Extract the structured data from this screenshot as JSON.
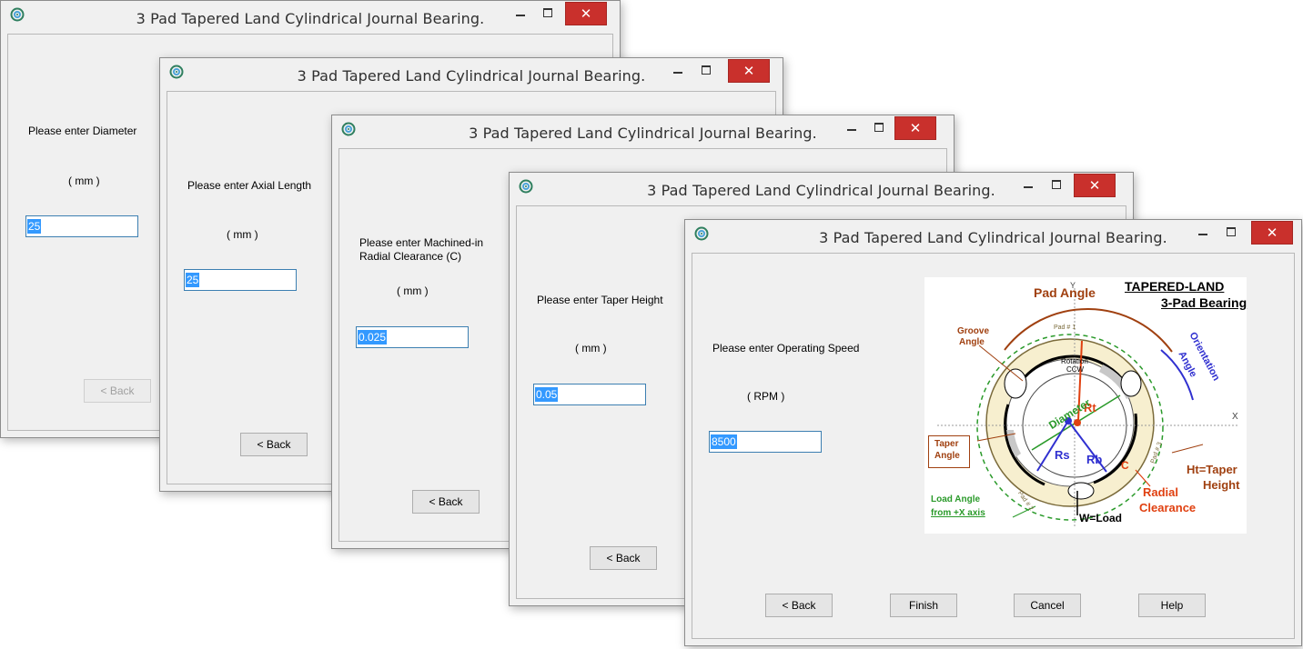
{
  "windows": [
    {
      "title": "3 Pad Tapered Land Cylindrical Journal Bearing.",
      "prompt": "Please enter Diameter",
      "unit": "( mm )",
      "value": "25",
      "back_label": "< Back"
    },
    {
      "title": "3 Pad Tapered Land Cylindrical Journal Bearing.",
      "prompt": "Please enter Axial Length",
      "unit": "( mm )",
      "value": "25",
      "back_label": "< Back"
    },
    {
      "title": "3 Pad Tapered Land Cylindrical Journal Bearing.",
      "prompt_line1": "Please enter Machined-in",
      "prompt_line2": "Radial Clearance (C)",
      "unit": "( mm )",
      "value": "0.025",
      "back_label": "< Back"
    },
    {
      "title": "3 Pad Tapered Land Cylindrical Journal Bearing.",
      "prompt": "Please enter Taper Height",
      "unit": "( mm )",
      "value": "0.05",
      "back_label": "< Back"
    },
    {
      "title": "3 Pad Tapered Land Cylindrical Journal Bearing.",
      "prompt": "Please enter Operating Speed",
      "unit": "( RPM )",
      "value": "8500",
      "back_label": "< Back",
      "finish_label": "Finish",
      "cancel_label": "Cancel",
      "help_label": "Help"
    }
  ],
  "diagram": {
    "title_line1": "TAPERED-LAND",
    "title_line2": "3-Pad Bearing",
    "pad_angle": "Pad Angle",
    "groove_angle_1": "Groove",
    "groove_angle_2": "Angle",
    "orientation_1": "Orientation",
    "orientation_2": "Angle",
    "rotation_1": "Rotation",
    "rotation_2": "CCW",
    "diameter": "Diameter",
    "rt": "Rt",
    "rs": "Rs",
    "rb": "Rb",
    "c": "C",
    "y_axis": "Y",
    "x_axis": "X",
    "taper_angle_1": "Taper",
    "taper_angle_2": "Angle",
    "ht_1": "Ht=Taper",
    "ht_2": "Height",
    "radial_1": "Radial",
    "radial_2": "Clearance",
    "load_angle_1": "Load Angle",
    "load_angle_2": "from +X axis",
    "load": "W=Load",
    "pad1": "Pad # 1",
    "pad2": "Pad # 2",
    "pad3": "Pad # 3"
  },
  "colors": {
    "close_button": "#c9302c",
    "selection": "#3399ff",
    "input_border": "#3c7fb1"
  },
  "icons": {
    "app": "app-bearing-icon",
    "minimize": "minimize-icon",
    "maximize": "maximize-icon",
    "close": "close-icon"
  }
}
